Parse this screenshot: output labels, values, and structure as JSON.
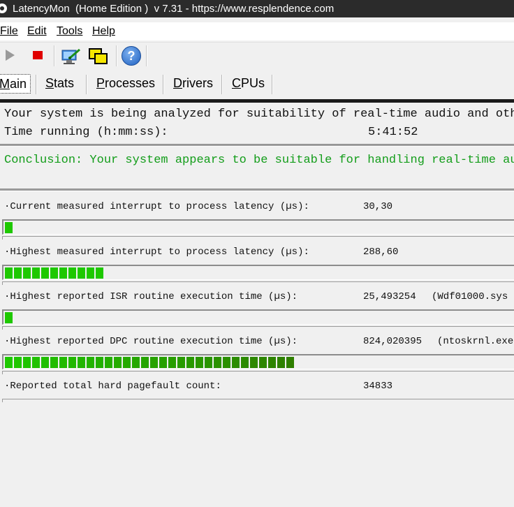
{
  "window": {
    "title": "LatencyMon  (Home Edition )  v 7.31 - https://www.resplendence.com"
  },
  "menu": [
    "File",
    "Edit",
    "Tools",
    "Help"
  ],
  "toolbar": {
    "icons": [
      "play-icon",
      "stop-icon",
      "analyze-icon",
      "windows-icon",
      "help-icon"
    ],
    "help_glyph": "?"
  },
  "tabs": [
    {
      "label": "Main",
      "underline": "M",
      "rest": "ain",
      "active": true
    },
    {
      "label": "Stats",
      "underline": "S",
      "rest": "tats"
    },
    {
      "label": "Processes",
      "underline": "P",
      "rest": "rocesses"
    },
    {
      "label": "Drivers",
      "underline": "D",
      "rest": "rivers"
    },
    {
      "label": "CPUs",
      "underline": "C",
      "rest": "PUs"
    }
  ],
  "status": {
    "line1": "Your system is being analyzed for suitability of real-time audio and othe",
    "time_label": "Time running (h:mm:ss):",
    "time_value": "5:41:52",
    "conclusion": "Conclusion: Your system appears to be suitable for handling real-time aud",
    "conclusion_color": "#139d1a"
  },
  "metrics": [
    {
      "label": "·Current measured interrupt to process latency (µs):",
      "value": "30,30",
      "extra": "",
      "segments": 1
    },
    {
      "label": "·Highest measured interrupt to process latency (µs):",
      "value": "288,60",
      "extra": "",
      "segments": 11
    },
    {
      "label": "·Highest reported ISR routine execution time (µs):",
      "value": "25,493254",
      "extra": "(Wdf01000.sys",
      "segments": 1
    },
    {
      "label": "·Highest reported DPC routine execution time (µs):",
      "value": "824,020395",
      "extra": "(ntoskrnl.exe",
      "segments": 32
    },
    {
      "label": "·Reported total hard pagefault count:",
      "value": "34833",
      "extra": "",
      "segments": 0
    }
  ],
  "colors": {
    "bar_green": "#1ec800",
    "bar_dark_green": "#2f7f00",
    "titlebar": "#2b2b2b"
  }
}
